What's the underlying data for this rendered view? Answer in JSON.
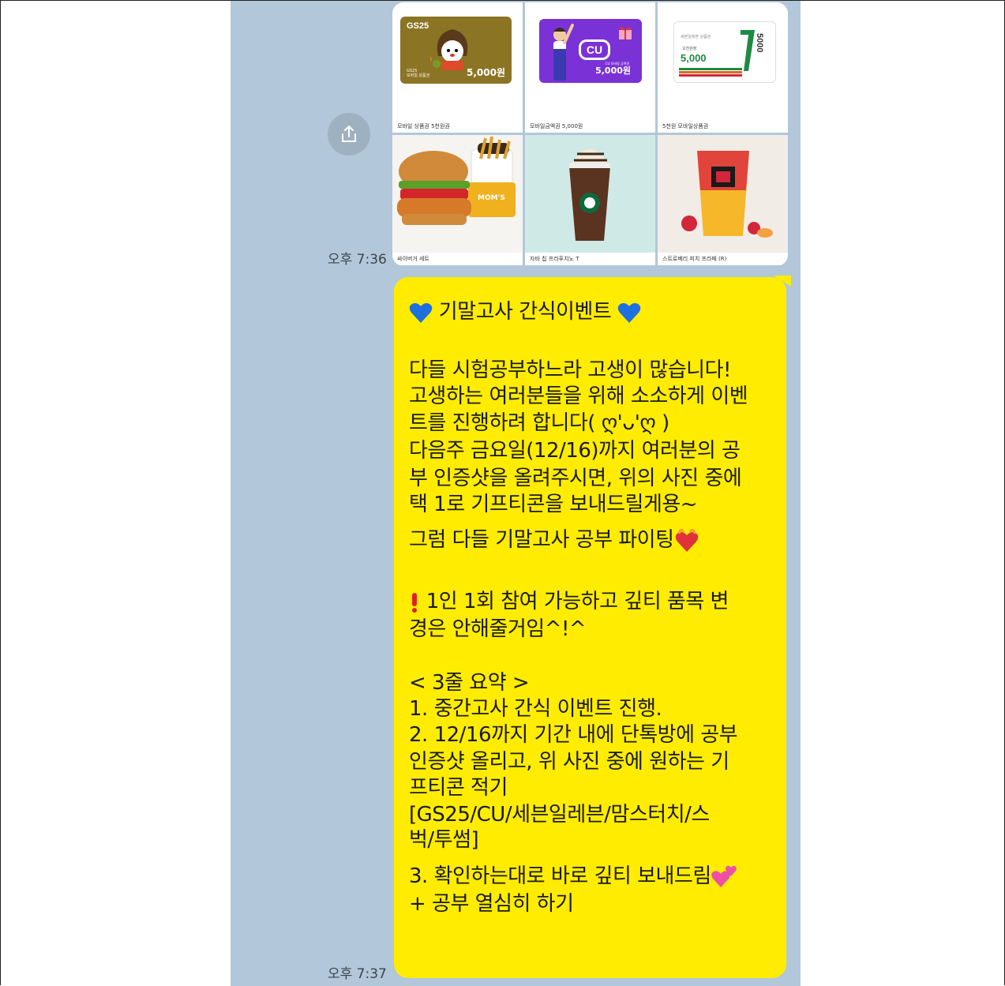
{
  "gifts": [
    {
      "caption": "모바일 상품권 5천원권",
      "brand": "GS25",
      "card_text": "GS25\n모바일 상품권",
      "amount": "5,000원"
    },
    {
      "caption": "모바일금액권 5,000원",
      "brand": "CU",
      "card_text": "CU 모바일 금액권",
      "amount": "5,000원"
    },
    {
      "caption": "5천원 모바일상품권",
      "brand": "세븐일레븐",
      "card_text_top": "세븐일레븐 상품권",
      "card_text_sub": "오천원정",
      "amount": "5,000",
      "vertical": "5000"
    },
    {
      "caption": "싸이버거 세트"
    },
    {
      "caption": "자바 칩 프라푸치노 T"
    },
    {
      "caption": "스트로베리 피치 프라페 (R)"
    }
  ],
  "times": {
    "first": "오후 7:36",
    "second": "오후 7:37"
  },
  "message": {
    "title": "기말고사 간식이벤트",
    "lines": [
      "다들 시험공부하느라 고생이 많습니다!",
      "고생하는 여러분들을 위해 소소하게 이벤",
      "트를 진행하려 합니다( ღ'ᴗ'ღ )",
      "다음주 금요일(12/16)까지 여러분의 공",
      "부 인증샷을 올려주시면, 위의 사진 중에",
      "택 1로 기프티콘을 보내드릴게용~",
      "그럼 다들 기말고사 공부 파이팅",
      "1인 1회 참여 가능하고 깊티 품목 변",
      "경은 안해줄거임^!^",
      "< 3줄 요약 >",
      "1. 중간고사 간식 이벤트 진행.",
      "2. 12/16까지 기간 내에 단톡방에 공부",
      "인증샷 올리고, 위 사진 중에 원하는 기",
      "프티콘 적기",
      "[GS25/CU/세븐일레븐/맘스터치/스",
      "벅/투썸]",
      "3. 확인하는대로 바로 깊티 보내드림",
      "+ 공부 열심히 하기"
    ]
  },
  "colors": {
    "bubble": "#ffec00",
    "chat_bg": "#b2c7d9"
  }
}
